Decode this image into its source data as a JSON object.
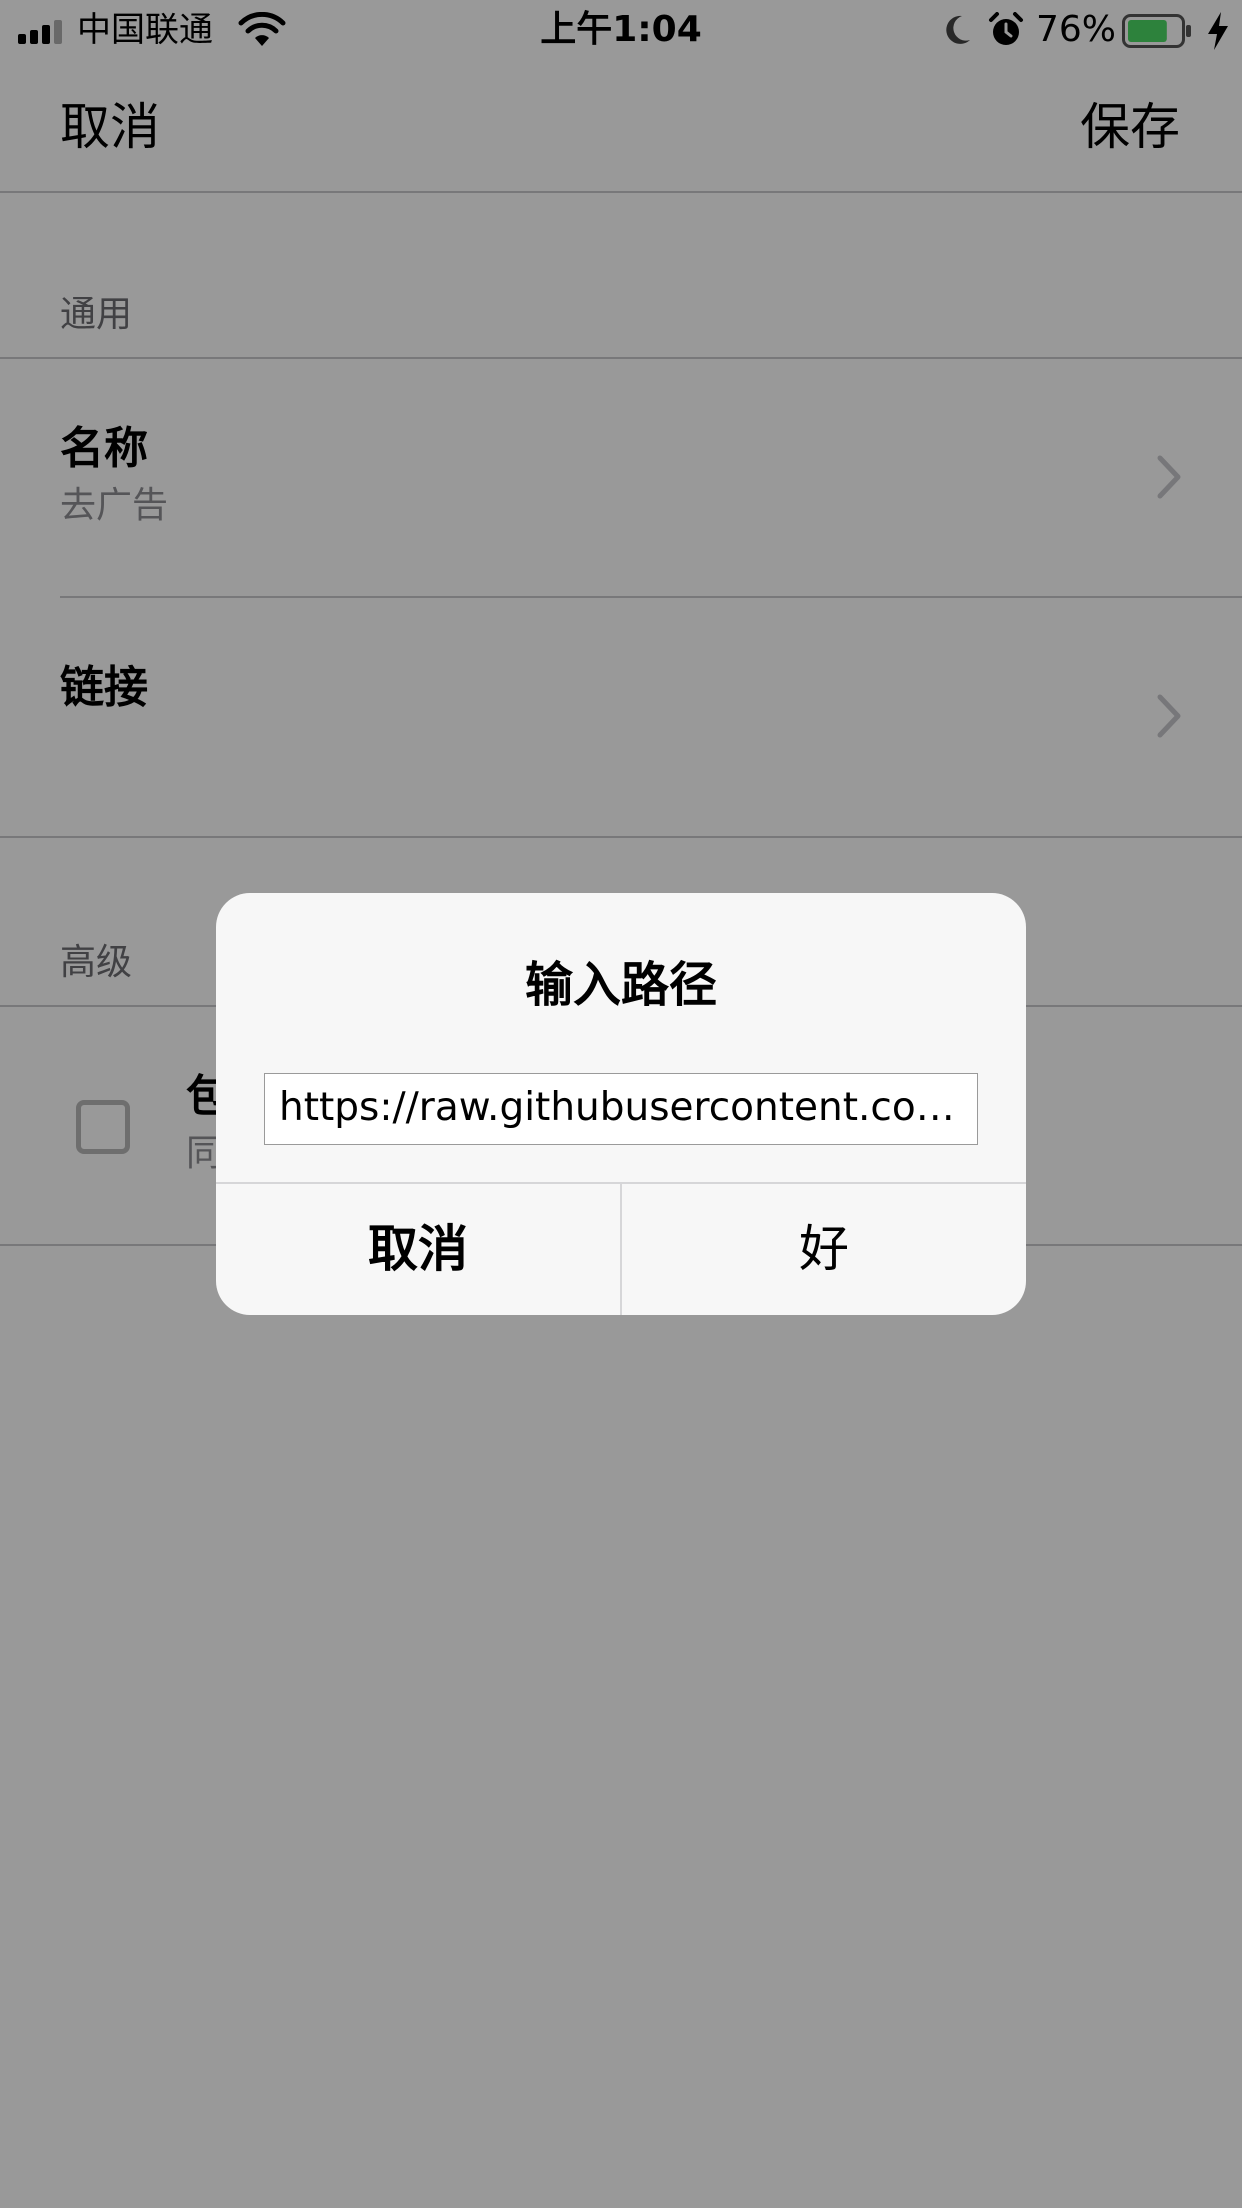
{
  "status_bar": {
    "carrier": "中国联通",
    "time": "上午1:04",
    "battery_percent": "76%",
    "battery_level": 0.76,
    "icons": [
      "signal-icon",
      "wifi-icon",
      "moon-icon",
      "alarm-icon",
      "battery-icon",
      "charging-icon"
    ]
  },
  "nav": {
    "cancel_label": "取消",
    "save_label": "保存"
  },
  "sections": {
    "general": {
      "title": "通用",
      "name_label": "名称",
      "name_value": "去广告",
      "link_label": "链接"
    },
    "advanced": {
      "title": "高级",
      "option_label": "包",
      "option_sub": "同"
    }
  },
  "alert": {
    "title": "输入路径",
    "input_value": "https://raw.githubusercontent.com/l...",
    "cancel_label": "取消",
    "ok_label": "好"
  },
  "colors": {
    "battery_fill": "#4cd964",
    "overlay": "rgba(0,0,0,0.40)"
  }
}
